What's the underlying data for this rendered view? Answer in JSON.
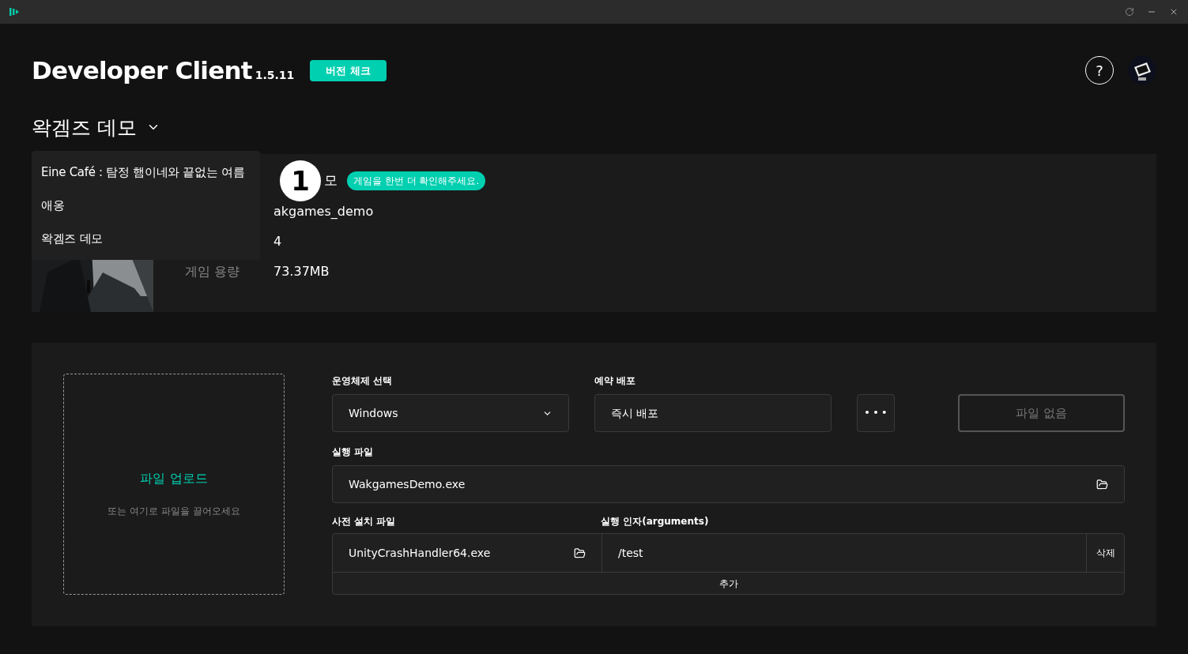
{
  "header": {
    "title": "Developer Client",
    "version": "1.5.11",
    "version_check_button": "버전 체크",
    "help_button": "?"
  },
  "project_selector": {
    "label": "왁겜즈 데모",
    "expanded": true,
    "options": [
      {
        "label": "Eine Café : 탐정 햄이네와 끝없는 여름"
      },
      {
        "label": "애옹"
      },
      {
        "label": "왁겜즈 데모"
      }
    ]
  },
  "game_info": {
    "step_badge": "1",
    "title_visible": "모",
    "hint": "게임을 한번 더 확인해주세요.",
    "rows": [
      {
        "value": "akgames_demo"
      },
      {
        "value": "4"
      },
      {
        "label": "게임 용량",
        "value": "73.37MB"
      }
    ]
  },
  "upload": {
    "title": "파일 업로드",
    "subtitle": "또는 여기로 파일을 끌어오세요"
  },
  "form": {
    "os": {
      "label": "운영체제 선택",
      "value": "Windows"
    },
    "schedule": {
      "label": "예약 배포",
      "value": "즉시 배포"
    },
    "more_button": "• • •",
    "file_button": {
      "label": "파일 없음",
      "disabled": true
    },
    "executable": {
      "label": "실행 파일",
      "value": "WakgamesDemo.exe"
    },
    "preinstall": {
      "label": "사전 설치 파일",
      "value": "UnityCrashHandler64.exe"
    },
    "arguments": {
      "label": "실행 인자(arguments)",
      "value": "/test",
      "delete_button": "삭제"
    },
    "add_button": "추가"
  }
}
